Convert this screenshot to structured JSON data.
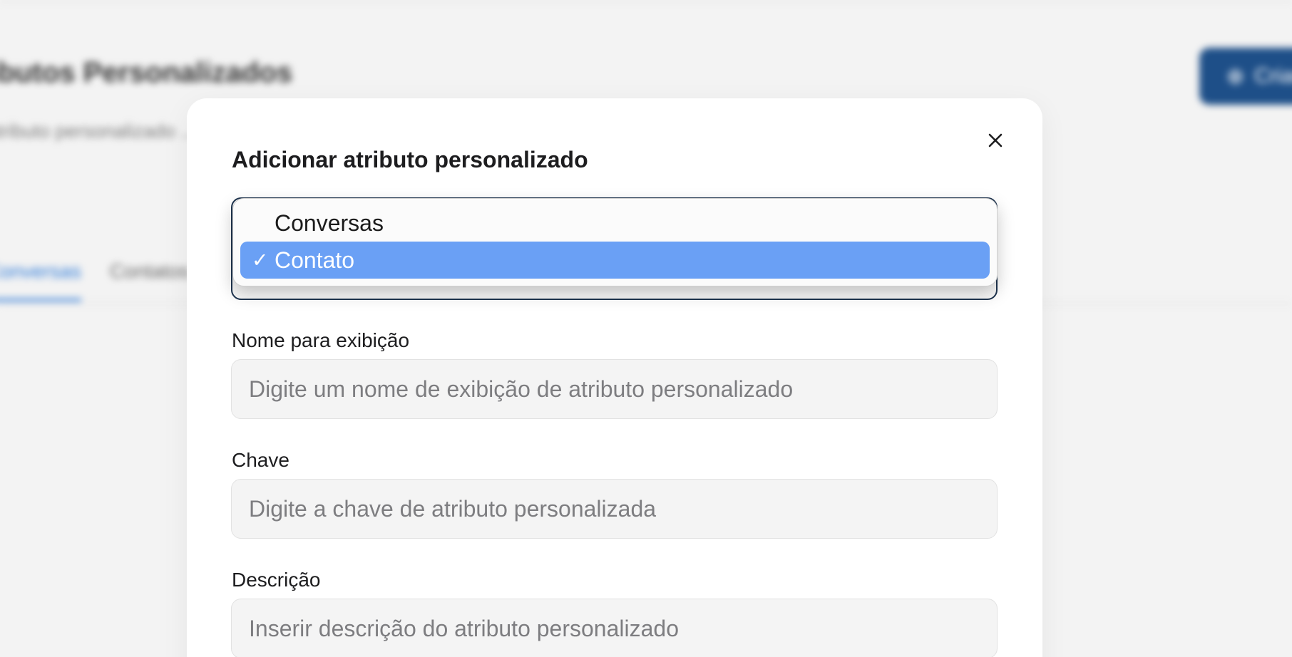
{
  "background": {
    "page_title": "ributos Personalizados",
    "description": "atributo personalizado ... informativos ou a data de ... texto, listas ou ...",
    "tabs": [
      {
        "label": "Conversas",
        "active": true
      },
      {
        "label": "Contatos",
        "active": false
      }
    ],
    "primary_button_label": "Criar"
  },
  "modal": {
    "title": "Adicionar atributo personalizado",
    "close_icon": "close-icon",
    "applies_to": {
      "options": [
        {
          "label": "Conversas",
          "selected": false
        },
        {
          "label": "Contato",
          "selected": true
        }
      ],
      "check_mark": "✓"
    },
    "display_name": {
      "label": "Nome para exibição",
      "placeholder": "Digite um nome de exibição de atributo personalizado",
      "value": ""
    },
    "key": {
      "label": "Chave",
      "placeholder": "Digite a chave de atributo personalizada",
      "value": ""
    },
    "description": {
      "label": "Descrição",
      "placeholder": "Inserir descrição do atributo personalizado",
      "value": ""
    }
  },
  "colors": {
    "selected_option": "#6aa0f5",
    "primary_button": "#1e4f88",
    "active_tab": "#2f7bd8"
  }
}
